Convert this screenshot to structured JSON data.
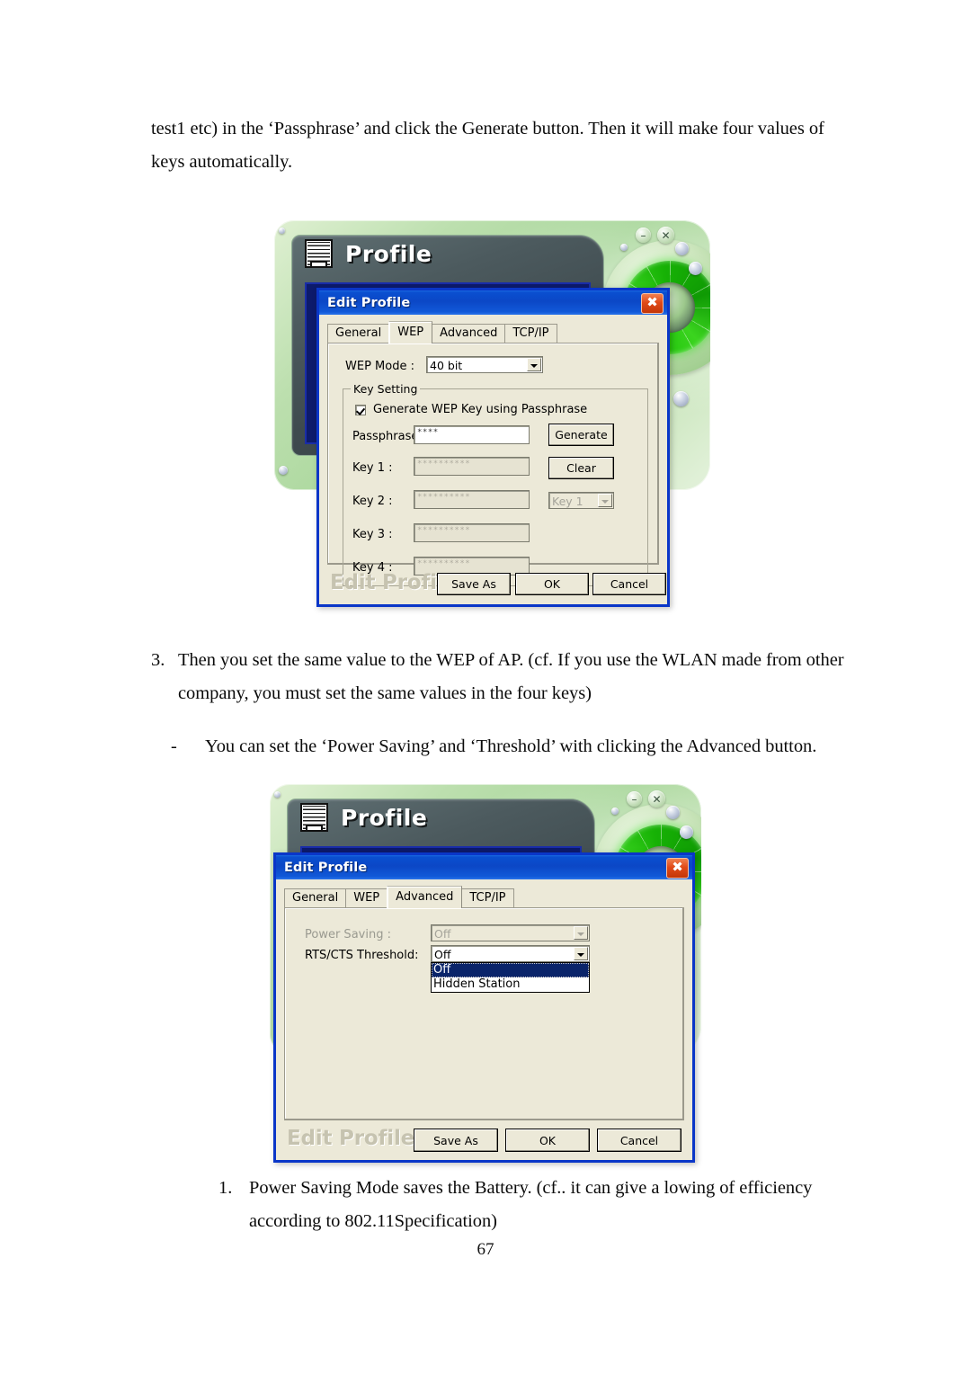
{
  "page": {
    "number": "67",
    "intro_paragraph": "test1 etc) in the ‘Passphrase’ and click the Generate button. Then it will make four values of keys automatically.",
    "step3_marker": "3.",
    "step3_text": "Then you set the same value to the WEP of AP. (cf. If  you use the WLAN  made from other company, you must set the same values in the four keys)",
    "dash_marker": "-",
    "dash_text": "You can set the ‘Power Saving’ and ‘Threshold’ with clicking the Advanced button.",
    "step1_marker": "1.",
    "step1_text": "Power Saving Mode saves the Battery. (cf.. it can  give a lowing of efficiency according to 802.11Specification)"
  },
  "colors": {
    "titlebar_blue": "#0b47c6",
    "dialog_face": "#ece9d8",
    "dialog_border": "#0a36c8",
    "close_red": "#e04a18",
    "shell_green": "#a9d79b",
    "dial_green": "#1fc40a",
    "select_highlight": "#0a246a"
  },
  "app_window": {
    "title": "Profile",
    "logo_icon": "profile-card-icon",
    "minimize_icon": "minimize-icon",
    "close_icon": "close-icon"
  },
  "dialog_wep": {
    "title": "Edit Profile",
    "close_icon": "close-icon",
    "tabs": [
      {
        "label": "General",
        "active": false
      },
      {
        "label": "WEP",
        "active": true
      },
      {
        "label": "Advanced",
        "active": false
      },
      {
        "label": "TCP/IP",
        "active": false
      }
    ],
    "wep_mode": {
      "label": "WEP Mode :",
      "value": "40 bit",
      "arrow_icon": "chevron-down-icon"
    },
    "key_setting": {
      "title": "Key Setting",
      "checkbox_label": "Generate WEP Key using Passphrase",
      "checkbox_checked": true,
      "passphrase": {
        "label": "Passphrase :",
        "value": "****"
      },
      "keys": [
        {
          "label": "Key 1 :",
          "value": "**********"
        },
        {
          "label": "Key 2 :",
          "value": "**********"
        },
        {
          "label": "Key 3 :",
          "value": "**********"
        },
        {
          "label": "Key 4 :",
          "value": "**********"
        }
      ],
      "generate_button": "Generate",
      "clear_button": "Clear",
      "default_key": {
        "value": "Key 1",
        "arrow_icon": "chevron-down-icon",
        "disabled": true
      }
    },
    "footer": {
      "brand": "Edit Profile",
      "save_as": "Save As",
      "ok": "OK",
      "cancel": "Cancel"
    }
  },
  "dialog_advanced": {
    "title": "Edit Profile",
    "close_icon": "close-icon",
    "tabs": [
      {
        "label": "General",
        "active": false
      },
      {
        "label": "WEP",
        "active": false
      },
      {
        "label": "Advanced",
        "active": true
      },
      {
        "label": "TCP/IP",
        "active": false
      }
    ],
    "power_saving": {
      "label": "Power Saving :",
      "value": "Off",
      "disabled": true,
      "arrow_icon": "chevron-down-icon"
    },
    "rts_cts_threshold": {
      "label": "RTS/CTS Threshold:",
      "value": "Off",
      "arrow_icon": "chevron-down-icon",
      "open": true,
      "options": [
        {
          "label": "Off",
          "selected": true
        },
        {
          "label": "Hidden Station",
          "selected": false
        }
      ]
    },
    "footer": {
      "brand": "Edit Profile",
      "save_as": "Save As",
      "ok": "OK",
      "cancel": "Cancel"
    }
  }
}
